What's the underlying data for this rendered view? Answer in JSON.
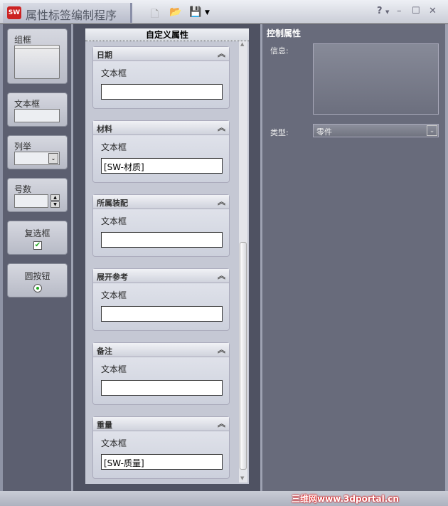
{
  "app": {
    "logo": "SW",
    "title": "属性标签编制程序"
  },
  "toolbar": {
    "new": "new-file-icon",
    "open": "open-folder-icon",
    "save": "save-icon",
    "help": "?"
  },
  "palette": {
    "group_box": "组框",
    "text_box": "文本框",
    "list": "列举",
    "number": "号数",
    "checkbox": "复选框",
    "radio": "圆按钮"
  },
  "canvas": {
    "title": "自定义属性",
    "groups": [
      {
        "title": "日期",
        "label": "文本框",
        "value": ""
      },
      {
        "title": "材料",
        "label": "文本框",
        "value": "[SW-材质]"
      },
      {
        "title": "所属装配",
        "label": "文本框",
        "value": ""
      },
      {
        "title": "展开参考",
        "label": "文本框",
        "value": ""
      },
      {
        "title": "备注",
        "label": "文本框",
        "value": ""
      },
      {
        "title": "重量",
        "label": "文本框",
        "value": "[SW-质量]"
      }
    ]
  },
  "props": {
    "title": "控制属性",
    "info_label": "信息:",
    "info_value": "",
    "type_label": "类型:",
    "type_value": "零件"
  },
  "watermark": "三维网www.3dportal.cn"
}
